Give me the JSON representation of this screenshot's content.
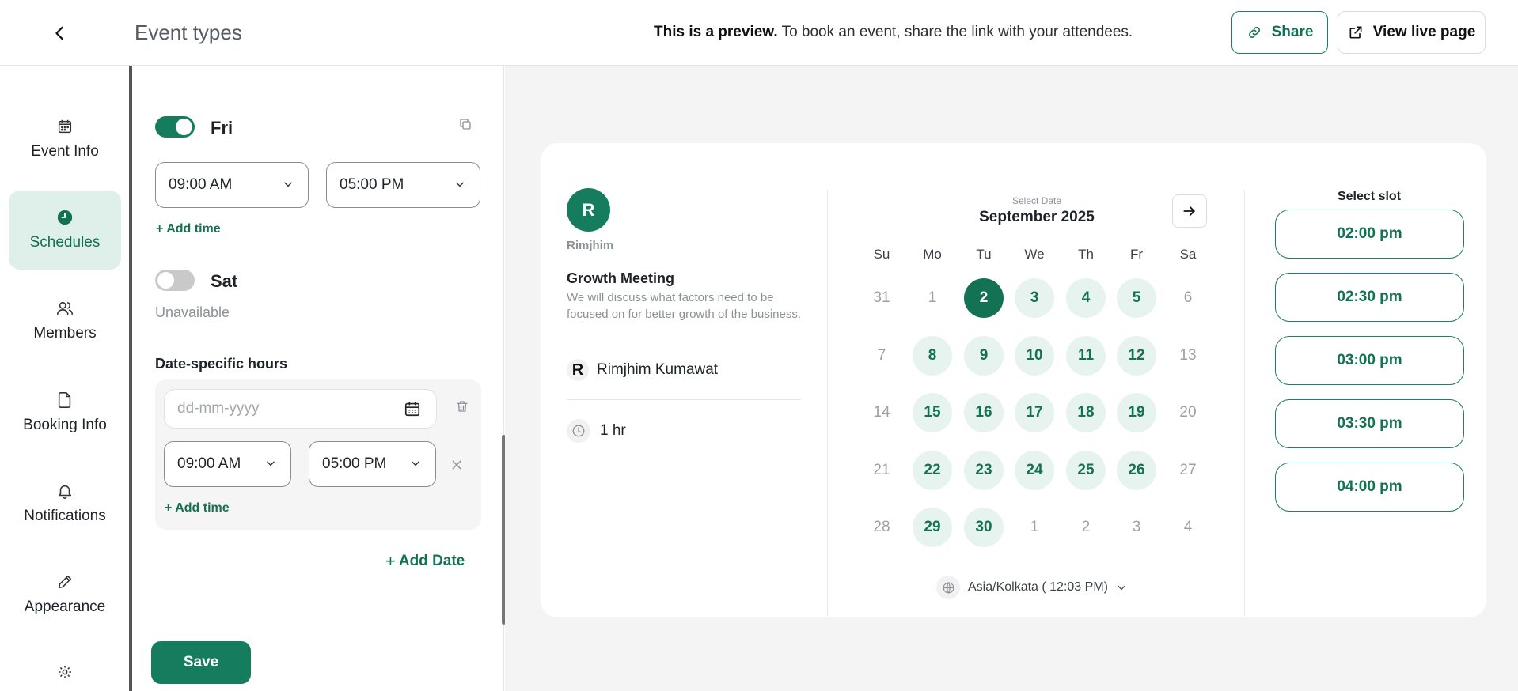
{
  "header": {
    "title": "Event types",
    "preview_bold": "This is a preview.",
    "preview_rest": " To book an event, share the link with your attendees.",
    "share_label": "Share",
    "live_label": "View live page"
  },
  "nav": {
    "items": [
      {
        "label": "Event Info",
        "icon": "calendar-icon"
      },
      {
        "label": "Schedules",
        "icon": "clock-icon"
      },
      {
        "label": "Members",
        "icon": "users-icon"
      },
      {
        "label": "Booking Info",
        "icon": "document-icon"
      },
      {
        "label": "Notifications",
        "icon": "bell-icon"
      },
      {
        "label": "Appearance",
        "icon": "pencil-icon"
      }
    ],
    "active": "Schedules"
  },
  "schedule": {
    "fri": {
      "day": "Fri",
      "enabled": true,
      "start": "09:00 AM",
      "end": "05:00 PM",
      "add_time": "+ Add time"
    },
    "sat": {
      "day": "Sat",
      "enabled": false,
      "status": "Unavailable"
    },
    "date_specific": {
      "title": "Date-specific hours",
      "date_placeholder": "dd-mm-yyyy",
      "start": "09:00 AM",
      "end": "05:00 PM",
      "add_time": "+ Add time"
    },
    "add_date": "Add Date",
    "save": "Save"
  },
  "preview": {
    "avatar_letter": "R",
    "host": "Rimjhim",
    "event_title": "Growth Meeting",
    "event_desc": "We will discuss what factors need to be focused on for better growth of the business.",
    "host_initial": "R",
    "host_full": "Rimjhim Kumawat",
    "duration": "1 hr",
    "select_date_label": "Select Date",
    "month": "September 2025",
    "weekdays": [
      "Su",
      "Mo",
      "Tu",
      "We",
      "Th",
      "Fr",
      "Sa"
    ],
    "weeks": [
      [
        [
          "31",
          "dim"
        ],
        [
          "1",
          "dim"
        ],
        [
          "2",
          "sel"
        ],
        [
          "3",
          "avail"
        ],
        [
          "4",
          "avail"
        ],
        [
          "5",
          "avail"
        ],
        [
          "6",
          "dim"
        ]
      ],
      [
        [
          "7",
          "dim"
        ],
        [
          "8",
          "avail"
        ],
        [
          "9",
          "avail"
        ],
        [
          "10",
          "avail"
        ],
        [
          "11",
          "avail"
        ],
        [
          "12",
          "avail"
        ],
        [
          "13",
          "dim"
        ]
      ],
      [
        [
          "14",
          "dim"
        ],
        [
          "15",
          "avail"
        ],
        [
          "16",
          "avail"
        ],
        [
          "17",
          "avail"
        ],
        [
          "18",
          "avail"
        ],
        [
          "19",
          "avail"
        ],
        [
          "20",
          "dim"
        ]
      ],
      [
        [
          "21",
          "dim"
        ],
        [
          "22",
          "avail"
        ],
        [
          "23",
          "avail"
        ],
        [
          "24",
          "avail"
        ],
        [
          "25",
          "avail"
        ],
        [
          "26",
          "avail"
        ],
        [
          "27",
          "dim"
        ]
      ],
      [
        [
          "28",
          "dim"
        ],
        [
          "29",
          "avail"
        ],
        [
          "30",
          "avail"
        ],
        [
          "1",
          "dim"
        ],
        [
          "2",
          "dim"
        ],
        [
          "3",
          "dim"
        ],
        [
          "4",
          "dim"
        ]
      ]
    ],
    "timezone": "Asia/Kolkata ( 12:03 PM)",
    "slot_title": "Select slot",
    "slots": [
      "02:00 pm",
      "02:30 pm",
      "03:00 pm",
      "03:30 pm",
      "04:00 pm"
    ]
  },
  "colors": {
    "accent": "#167c5e",
    "accent_light": "#e6f3ee"
  }
}
